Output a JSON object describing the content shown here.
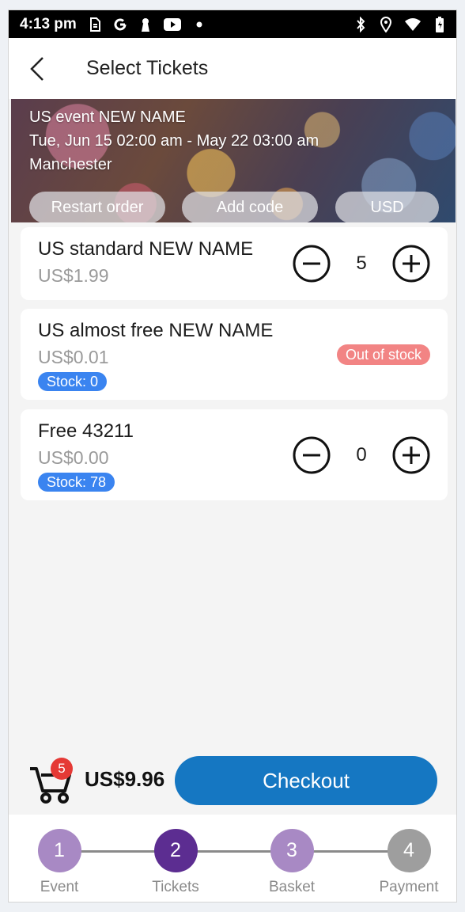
{
  "status_bar": {
    "time": "4:13 pm",
    "left_icons": [
      "sim-icon",
      "google-icon",
      "keyhole-icon",
      "youtube-icon",
      "dot-icon"
    ],
    "right_icons": [
      "bluetooth-icon",
      "location-icon",
      "wifi-icon",
      "battery-icon"
    ]
  },
  "app_bar": {
    "title": "Select Tickets",
    "back_icon": "back-arrow-icon"
  },
  "event": {
    "name": "US event NEW NAME",
    "dates": "Tue, Jun 15 02:00 am - May 22 03:00 am",
    "location": "Manchester",
    "buttons": {
      "restart": "Restart order",
      "add_code": "Add code",
      "currency": "USD"
    }
  },
  "tickets": [
    {
      "name": "US standard NEW NAME",
      "price": "US$1.99",
      "quantity": "5"
    },
    {
      "name": "US almost free NEW NAME",
      "price": "US$0.01",
      "stock": "Stock: 0",
      "status": "Out of stock"
    },
    {
      "name": "Free 43211",
      "price": "US$0.00",
      "stock": "Stock: 78",
      "quantity": "0"
    }
  ],
  "checkout": {
    "cart_count": "5",
    "total": "US$9.96",
    "button_label": "Checkout"
  },
  "steps": [
    {
      "number": "1",
      "label": "Event",
      "state": "done"
    },
    {
      "number": "2",
      "label": "Tickets",
      "state": "active"
    },
    {
      "number": "3",
      "label": "Basket",
      "state": "pending"
    },
    {
      "number": "4",
      "label": "Payment",
      "state": "pending"
    }
  ],
  "colors": {
    "primary": "#1577c2",
    "step_done": "#a889c4",
    "step_active": "#5c2d91",
    "step_pending": "#a889c4",
    "step_last": "#9e9e9e",
    "stock_badge": "#3a84f0",
    "out_of_stock": "#f28484",
    "cart_badge": "#e53935"
  }
}
